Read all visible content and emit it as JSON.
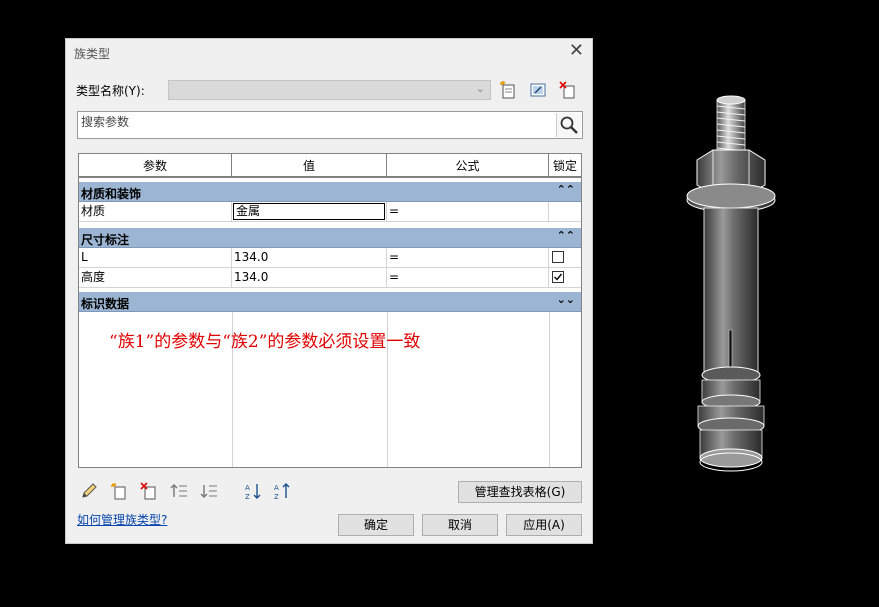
{
  "dialog": {
    "title": "族类型",
    "type_name_label": "类型名称(Y):",
    "type_name_value": "",
    "search_placeholder": "搜索参数"
  },
  "table": {
    "columns": [
      "参数",
      "值",
      "公式",
      "锁定"
    ],
    "groups": [
      {
        "name": "材质和装饰",
        "rows": [
          {
            "param": "材质",
            "value": "金属",
            "formula": "=",
            "locked": null
          }
        ]
      },
      {
        "name": "尺寸标注",
        "rows": [
          {
            "param": "L",
            "value": "134.0",
            "formula": "=",
            "locked": false
          },
          {
            "param": "高度",
            "value": "134.0",
            "formula": "=",
            "locked": true
          }
        ]
      },
      {
        "name": "标识数据",
        "rows": []
      }
    ],
    "annotation": "“族1”的参数与“族2”的参数必须设置一致"
  },
  "buttons": {
    "lookup_tables": "管理查找表格(G)",
    "ok": "确定",
    "cancel": "取消",
    "apply": "应用(A)"
  },
  "help_link": "如何管理族类型?",
  "colors": {
    "group_header": "#9bb5d3",
    "annotation": "#e10000",
    "link": "#0645ad"
  },
  "icons": [
    "new-type-icon",
    "rename-type-icon",
    "delete-type-icon",
    "search-icon",
    "edit-pencil-icon",
    "new-parameter-icon",
    "delete-parameter-icon",
    "move-up-icon",
    "move-down-icon",
    "sort-ascending-icon",
    "sort-descending-icon"
  ]
}
